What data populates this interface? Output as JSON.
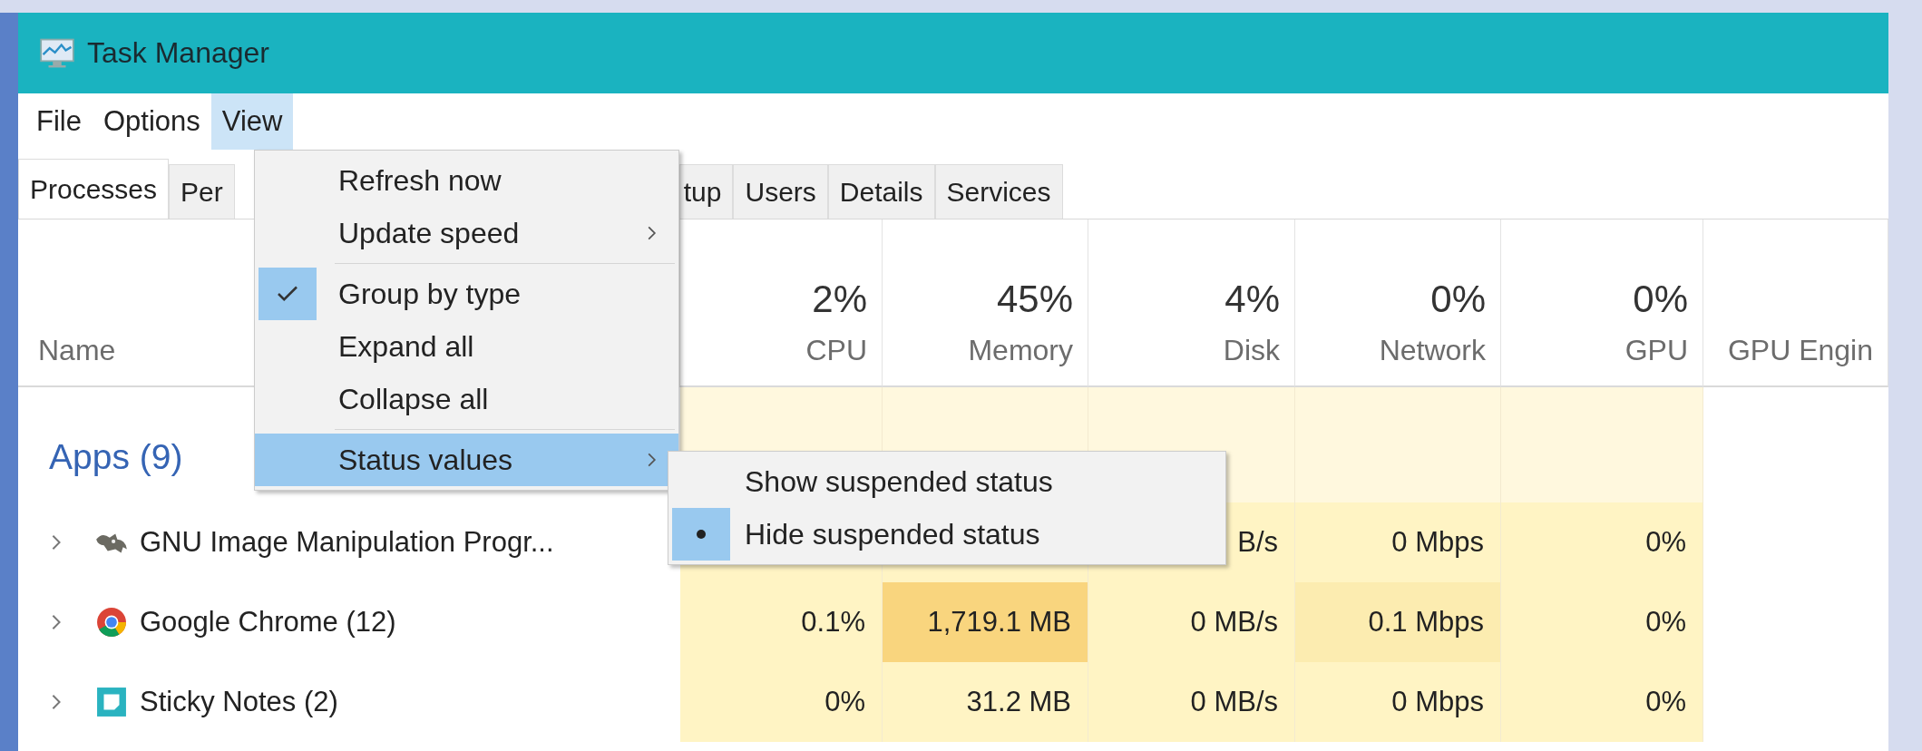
{
  "window": {
    "title": "Task Manager"
  },
  "menubar": [
    {
      "label": "File",
      "selected": false
    },
    {
      "label": "Options",
      "selected": false
    },
    {
      "label": "View",
      "selected": true
    }
  ],
  "tabs": [
    {
      "label": "Processes",
      "selected": true
    },
    {
      "label": "Per",
      "selected": false
    },
    {
      "label": "tup",
      "selected": false
    },
    {
      "label": "Users",
      "selected": false
    },
    {
      "label": "Details",
      "selected": false
    },
    {
      "label": "Services",
      "selected": false
    }
  ],
  "columns": [
    {
      "label": "Name"
    },
    {
      "percent": "2%",
      "label": "CPU"
    },
    {
      "percent": "45%",
      "label": "Memory"
    },
    {
      "percent": "4%",
      "label": "Disk"
    },
    {
      "percent": "0%",
      "label": "Network"
    },
    {
      "percent": "0%",
      "label": "GPU"
    },
    {
      "label": "GPU Engin"
    }
  ],
  "rows": [
    {
      "kind": "group",
      "name": "Apps (9)",
      "cells": [
        {
          "color": "#fff8de"
        },
        {
          "color": "#fff8de"
        },
        {
          "color": "#fff8de"
        },
        {
          "color": "#fff8de"
        },
        {
          "color": "#fff8de"
        }
      ]
    },
    {
      "kind": "process",
      "name": "GNU Image Manipulation Progr...",
      "cells": [
        {
          "color": "#fff4c4"
        },
        {
          "color": "#fff4c4"
        },
        {
          "text": "B/s",
          "color": "#fff4c4"
        },
        {
          "text": "0 Mbps",
          "color": "#fff4c4"
        },
        {
          "text": "0%",
          "color": "#fff4c4"
        }
      ]
    },
    {
      "kind": "process",
      "name": "Google Chrome (12)",
      "cells": [
        {
          "text": "0.1%",
          "color": "#fff4c4"
        },
        {
          "text": "1,719.1 MB",
          "color": "#f9d57e"
        },
        {
          "text": "0 MB/s",
          "color": "#fff4c4"
        },
        {
          "text": "0.1 Mbps",
          "color": "#fcecb0"
        },
        {
          "text": "0%",
          "color": "#fff4c4"
        }
      ]
    },
    {
      "kind": "process",
      "name": "Sticky Notes (2)",
      "cells": [
        {
          "text": "0%",
          "color": "#fff4c4"
        },
        {
          "text": "31.2 MB",
          "color": "#fff4c4"
        },
        {
          "text": "0 MB/s",
          "color": "#fff4c4"
        },
        {
          "text": "0 Mbps",
          "color": "#fff4c4"
        },
        {
          "text": "0%",
          "color": "#fff4c4"
        }
      ]
    }
  ],
  "view_menu": [
    {
      "kind": "item",
      "label": "Refresh now",
      "submenu": false,
      "checked": false,
      "highlighted": false
    },
    {
      "kind": "item",
      "label": "Update speed",
      "submenu": true,
      "checked": false,
      "highlighted": false
    },
    {
      "kind": "separator"
    },
    {
      "kind": "item",
      "label": "Group by type",
      "submenu": false,
      "checked": true,
      "highlighted": false
    },
    {
      "kind": "item",
      "label": "Expand all",
      "submenu": false,
      "checked": false,
      "highlighted": false
    },
    {
      "kind": "item",
      "label": "Collapse all",
      "submenu": false,
      "checked": false,
      "highlighted": false
    },
    {
      "kind": "separator"
    },
    {
      "kind": "item",
      "label": "Status values",
      "submenu": true,
      "checked": false,
      "highlighted": true
    }
  ],
  "status_submenu": [
    {
      "label": "Show suspended status",
      "selected": false
    },
    {
      "label": "Hide suspended status",
      "selected": true
    }
  ]
}
